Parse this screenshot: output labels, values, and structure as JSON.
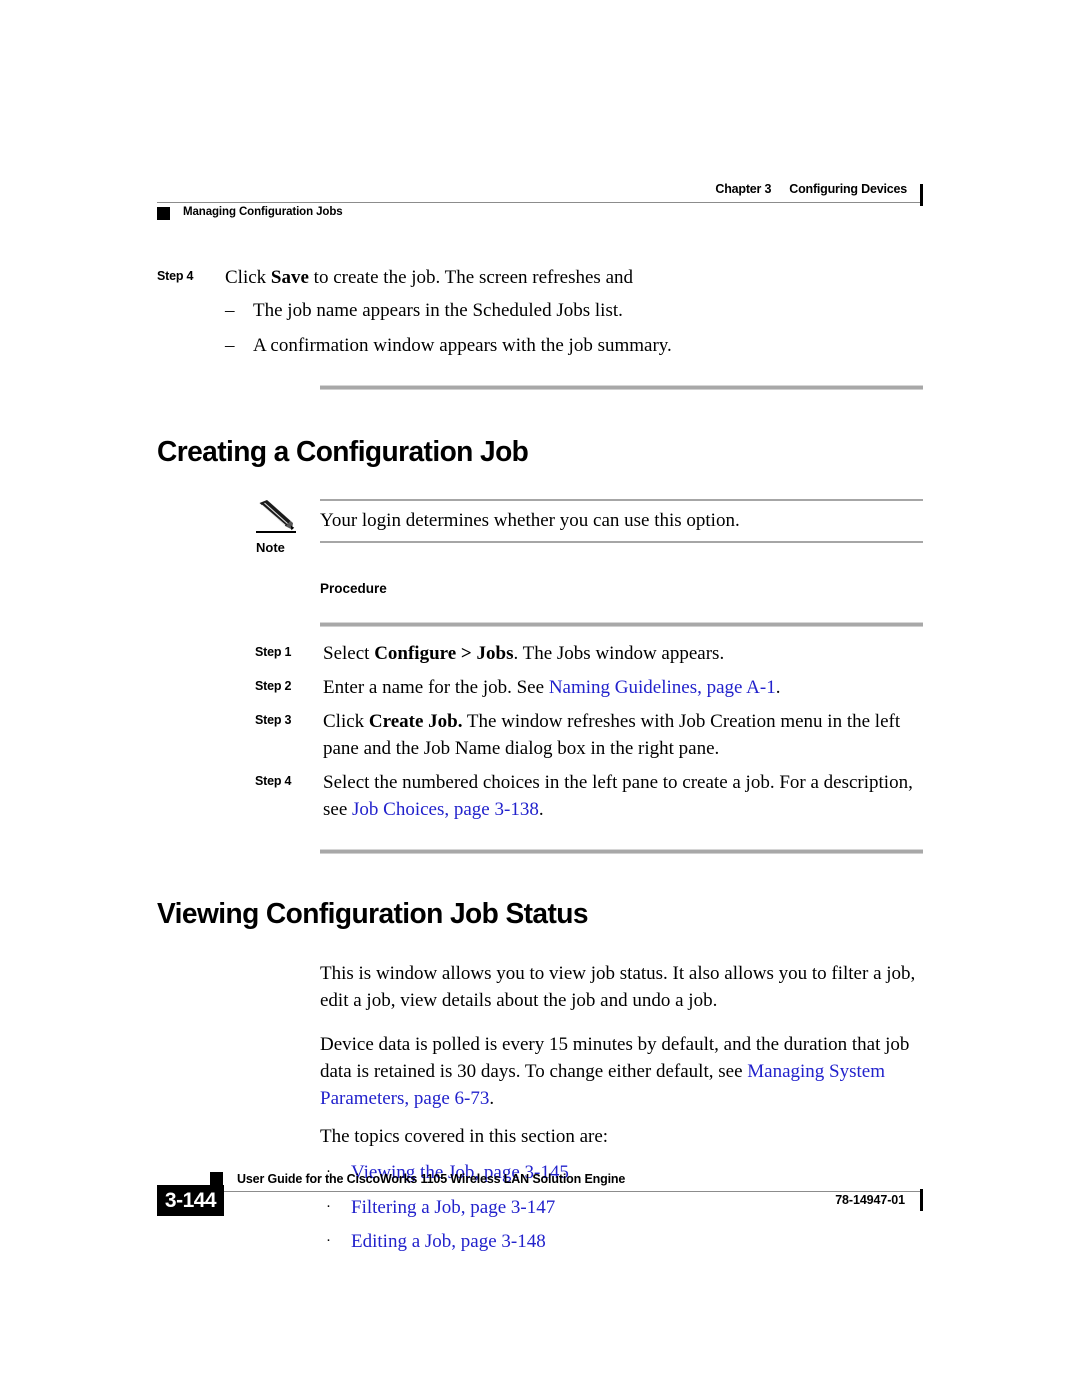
{
  "header": {
    "chapter": "Chapter 3",
    "chapter_title": "Configuring Devices",
    "running_section": "Managing Configuration Jobs"
  },
  "intro_step": {
    "label": "Step 4",
    "text_before": "Click ",
    "text_bold": "Save",
    "text_after": " to create the job. The screen refreshes and",
    "sub_items": [
      {
        "marker": "–",
        "text": "The job name appears in the Scheduled Jobs list."
      },
      {
        "marker": "–",
        "text": "A confirmation window appears with the job summary."
      }
    ]
  },
  "section_creating": {
    "title": "Creating a Configuration Job",
    "note": {
      "icon": "pencil-icon",
      "label": "Note",
      "text": "Your login determines whether you can use this option."
    },
    "procedure_label": "Procedure",
    "steps": [
      {
        "label": "Step 1",
        "segments": [
          {
            "type": "plain",
            "text": "Select "
          },
          {
            "type": "bold",
            "text": "Configure > Jobs"
          },
          {
            "type": "plain",
            "text": ". The Jobs window appears."
          }
        ]
      },
      {
        "label": "Step 2",
        "segments": [
          {
            "type": "plain",
            "text": "Enter a name for the job. See "
          },
          {
            "type": "link",
            "text": "Naming Guidelines, page A-1"
          },
          {
            "type": "plain",
            "text": "."
          }
        ]
      },
      {
        "label": "Step 3",
        "segments": [
          {
            "type": "plain",
            "text": "Click "
          },
          {
            "type": "bold",
            "text": "Create Job."
          },
          {
            "type": "plain",
            "text": " The window refreshes with Job Creation menu in the left pane and the Job Name dialog box in the right pane."
          }
        ]
      },
      {
        "label": "Step 4",
        "segments": [
          {
            "type": "plain",
            "text": "Select the numbered choices in the left pane to create a job. For a description, see "
          },
          {
            "type": "link",
            "text": "Job Choices, page 3-138"
          },
          {
            "type": "plain",
            "text": "."
          }
        ]
      }
    ]
  },
  "section_viewing": {
    "title": "Viewing Configuration Job Status",
    "paragraph_1": "This is window allows you to view job status. It also allows you to filter a job, edit a job, view details about the job and undo a job.",
    "paragraph_2": {
      "segments": [
        {
          "type": "plain",
          "text": "Device data is polled is every 15 minutes by default, and the duration that job data is retained is 30 days. To change either default, see "
        },
        {
          "type": "link",
          "text": "Managing System Parameters, page 6-73"
        },
        {
          "type": "plain",
          "text": "."
        }
      ]
    },
    "topics_intro": "The topics covered in this section are:",
    "topics": [
      {
        "marker": "·",
        "text": "Viewing the Job, page 3-145"
      },
      {
        "marker": "·",
        "text": "Filtering a Job, page 3-147"
      },
      {
        "marker": "·",
        "text": "Editing a Job, page 3-148"
      }
    ]
  },
  "footer": {
    "page_number": "3-144",
    "guide_title": "User Guide for the CiscoWorks 1105 Wireless LAN Solution Engine",
    "doc_number": "78-14947-01"
  },
  "colors": {
    "link": "#2222cc",
    "rule": "#a8a8a8",
    "text": "#000000"
  }
}
